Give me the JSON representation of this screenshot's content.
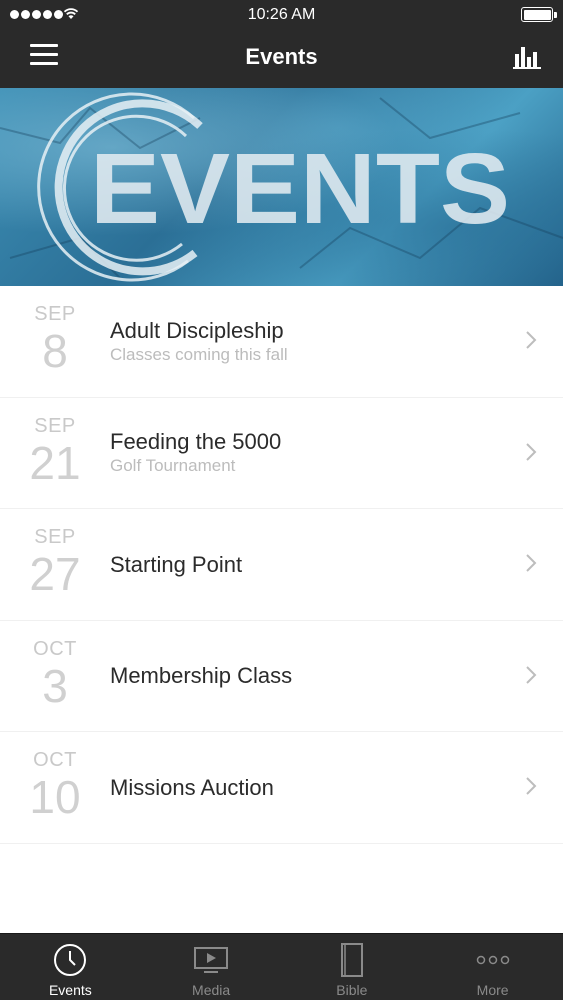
{
  "status_bar": {
    "time": "10:26 AM"
  },
  "nav": {
    "title": "Events"
  },
  "banner": {
    "text": "EVENTS"
  },
  "events": [
    {
      "month": "SEP",
      "day": "8",
      "title": "Adult Discipleship",
      "subtitle": "Classes coming this fall"
    },
    {
      "month": "SEP",
      "day": "21",
      "title": "Feeding the 5000",
      "subtitle": "Golf Tournament"
    },
    {
      "month": "SEP",
      "day": "27",
      "title": "Starting Point",
      "subtitle": ""
    },
    {
      "month": "OCT",
      "day": "3",
      "title": "Membership Class",
      "subtitle": ""
    },
    {
      "month": "OCT",
      "day": "10",
      "title": "Missions Auction",
      "subtitle": ""
    }
  ],
  "tabs": [
    {
      "label": "Events",
      "icon": "clock-icon"
    },
    {
      "label": "Media",
      "icon": "play-screen-icon"
    },
    {
      "label": "Bible",
      "icon": "book-icon"
    },
    {
      "label": "More",
      "icon": "more-dots-icon"
    }
  ],
  "colors": {
    "bar_bg": "#2a2a2a",
    "active_tab": "#ffffff",
    "inactive_tab": "#8a8a8a",
    "date_gray": "#c9c9c9"
  }
}
